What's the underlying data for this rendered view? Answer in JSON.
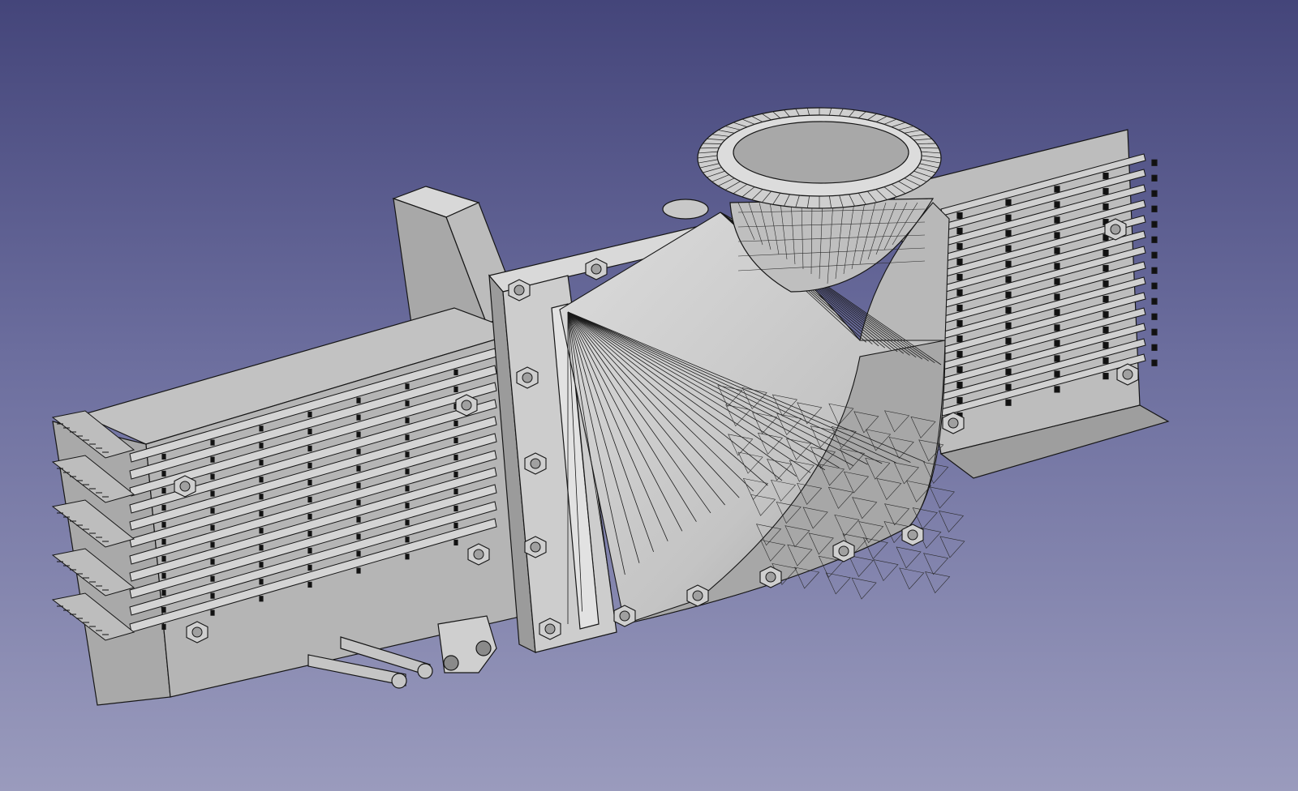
{
  "viewport": {
    "background_top": "#44457a",
    "background_bottom": "#9a9bbd",
    "model_colors": {
      "face": "#c9c9c9",
      "face_light": "#e0e0e0",
      "face_mid": "#b4b4b4",
      "face_dark": "#8e8e8e",
      "edge": "#161616"
    }
  },
  "scene": {
    "parts": [
      "grille-left",
      "grille-right",
      "flange-plate",
      "bracket-block",
      "elbow-duct",
      "top-ring-flange",
      "tie-rods",
      "bolts"
    ]
  }
}
